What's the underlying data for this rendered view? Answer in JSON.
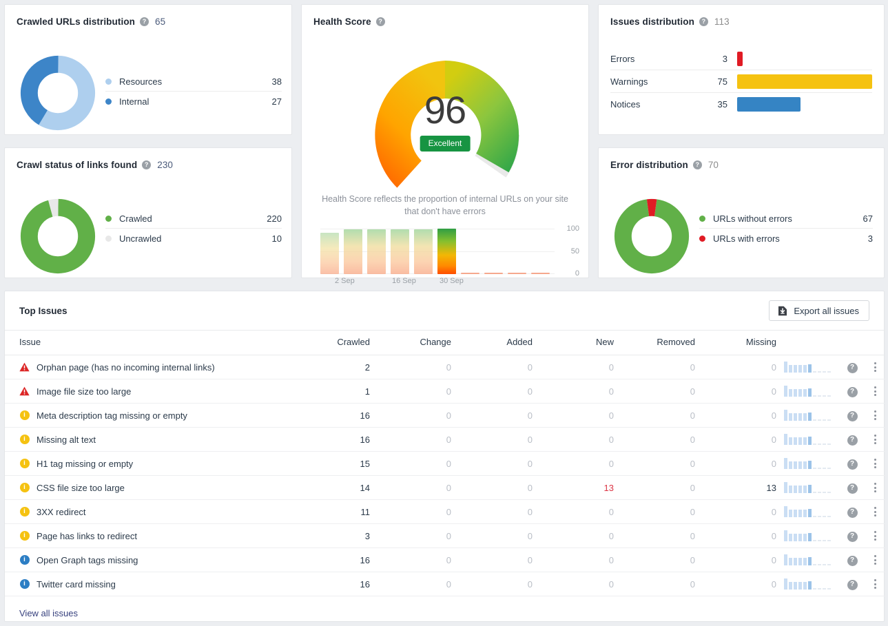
{
  "cards": {
    "crawled_urls": {
      "title": "Crawled URLs distribution",
      "total": "65",
      "help": "help-icon",
      "legend": [
        {
          "label": "Resources",
          "value": "38",
          "color": "#aecfee"
        },
        {
          "label": "Internal",
          "value": "27",
          "color": "#3d85c8"
        }
      ]
    },
    "crawl_status": {
      "title": "Crawl status of links found",
      "total": "230",
      "help": "help-icon",
      "legend": [
        {
          "label": "Crawled",
          "value": "220",
          "color": "#61b048"
        },
        {
          "label": "Uncrawled",
          "value": "10",
          "color": "#e8e8e8"
        }
      ]
    },
    "health_score": {
      "title": "Health Score",
      "help": "help-icon",
      "score": "96",
      "badge": "Excellent",
      "badge_color": "#179442",
      "description": "Health Score reflects the proportion of internal URLs on your site that don't have errors"
    },
    "issues_distribution": {
      "title": "Issues distribution",
      "total": "113",
      "help": "help-icon",
      "rows": [
        {
          "label": "Errors",
          "value": "3",
          "color": "#e01b24",
          "pct": 4
        },
        {
          "label": "Warnings",
          "value": "75",
          "color": "#f5c211",
          "pct": 100
        },
        {
          "label": "Notices",
          "value": "35",
          "color": "#3584c4",
          "pct": 46.7
        }
      ]
    },
    "error_distribution": {
      "title": "Error distribution",
      "total": "70",
      "help": "help-icon",
      "legend": [
        {
          "label": "URLs without errors",
          "value": "67",
          "color": "#61b048"
        },
        {
          "label": "URLs with errors",
          "value": "3",
          "color": "#e01b24"
        }
      ]
    }
  },
  "top_issues": {
    "title": "Top Issues",
    "export_label": "Export all issues",
    "export_icon": "download-file-icon",
    "columns": [
      "Issue",
      "Crawled",
      "Change",
      "Added",
      "New",
      "Removed",
      "Missing"
    ],
    "rows": [
      {
        "severity": "error",
        "label": "Orphan page (has no incoming internal links)",
        "crawled": "2",
        "change": "0",
        "added": "0",
        "new": "0",
        "removed": "0",
        "missing": "0"
      },
      {
        "severity": "error",
        "label": "Image file size too large",
        "crawled": "1",
        "change": "0",
        "added": "0",
        "new": "0",
        "removed": "0",
        "missing": "0"
      },
      {
        "severity": "warning",
        "label": "Meta description tag missing or empty",
        "crawled": "16",
        "change": "0",
        "added": "0",
        "new": "0",
        "removed": "0",
        "missing": "0"
      },
      {
        "severity": "warning",
        "label": "Missing alt text",
        "crawled": "16",
        "change": "0",
        "added": "0",
        "new": "0",
        "removed": "0",
        "missing": "0"
      },
      {
        "severity": "warning",
        "label": "H1 tag missing or empty",
        "crawled": "15",
        "change": "0",
        "added": "0",
        "new": "0",
        "removed": "0",
        "missing": "0"
      },
      {
        "severity": "warning",
        "label": "CSS file size too large",
        "crawled": "14",
        "change": "0",
        "added": "0",
        "new": "13",
        "removed": "0",
        "missing": "13"
      },
      {
        "severity": "warning",
        "label": "3XX redirect",
        "crawled": "11",
        "change": "0",
        "added": "0",
        "new": "0",
        "removed": "0",
        "missing": "0"
      },
      {
        "severity": "warning",
        "label": "Page has links to redirect",
        "crawled": "3",
        "change": "0",
        "added": "0",
        "new": "0",
        "removed": "0",
        "missing": "0"
      },
      {
        "severity": "notice",
        "label": "Open Graph tags missing",
        "crawled": "16",
        "change": "0",
        "added": "0",
        "new": "0",
        "removed": "0",
        "missing": "0"
      },
      {
        "severity": "notice",
        "label": "Twitter card missing",
        "crawled": "16",
        "change": "0",
        "added": "0",
        "new": "0",
        "removed": "0",
        "missing": "0"
      }
    ],
    "row_help_icon": "help-icon",
    "row_menu_icon": "kebab-menu-icon",
    "view_all_label": "View all issues"
  },
  "chart_data": [
    {
      "type": "pie",
      "title": "Crawled URLs distribution",
      "categories": [
        "Resources",
        "Internal"
      ],
      "values": [
        38,
        27
      ],
      "total": 65,
      "colors": [
        "#aecfee",
        "#3d85c8"
      ],
      "legend": "right"
    },
    {
      "type": "pie",
      "title": "Crawl status of links found",
      "categories": [
        "Crawled",
        "Uncrawled"
      ],
      "values": [
        220,
        10
      ],
      "total": 230,
      "colors": [
        "#61b048",
        "#e8e8e8"
      ],
      "legend": "right"
    },
    {
      "type": "pie",
      "title": "Error distribution",
      "categories": [
        "URLs without errors",
        "URLs with errors"
      ],
      "values": [
        67,
        3
      ],
      "total": 70,
      "colors": [
        "#61b048",
        "#e01b24"
      ],
      "legend": "right"
    },
    {
      "type": "bar",
      "title": "Issues distribution",
      "categories": [
        "Errors",
        "Warnings",
        "Notices"
      ],
      "values": [
        3,
        75,
        35
      ],
      "colors": [
        "#e01b24",
        "#f5c211",
        "#3584c4"
      ],
      "total": 113,
      "orientation": "horizontal"
    },
    {
      "type": "gauge",
      "title": "Health Score",
      "value": 96,
      "ylim": [
        0,
        100
      ],
      "label": "Excellent"
    },
    {
      "type": "bar",
      "title": "Health Score history",
      "x": [
        "",
        "2 Sep",
        "",
        "16 Sep",
        "",
        "30 Sep",
        "",
        "",
        "",
        ""
      ],
      "values": [
        92,
        96,
        96,
        96,
        96,
        96,
        0,
        0,
        0,
        0
      ],
      "ylim": [
        0,
        100
      ],
      "yticks": [
        0,
        50,
        100
      ],
      "xlabels": [
        "2 Sep",
        "16 Sep",
        "30 Sep"
      ],
      "grid": true
    }
  ]
}
